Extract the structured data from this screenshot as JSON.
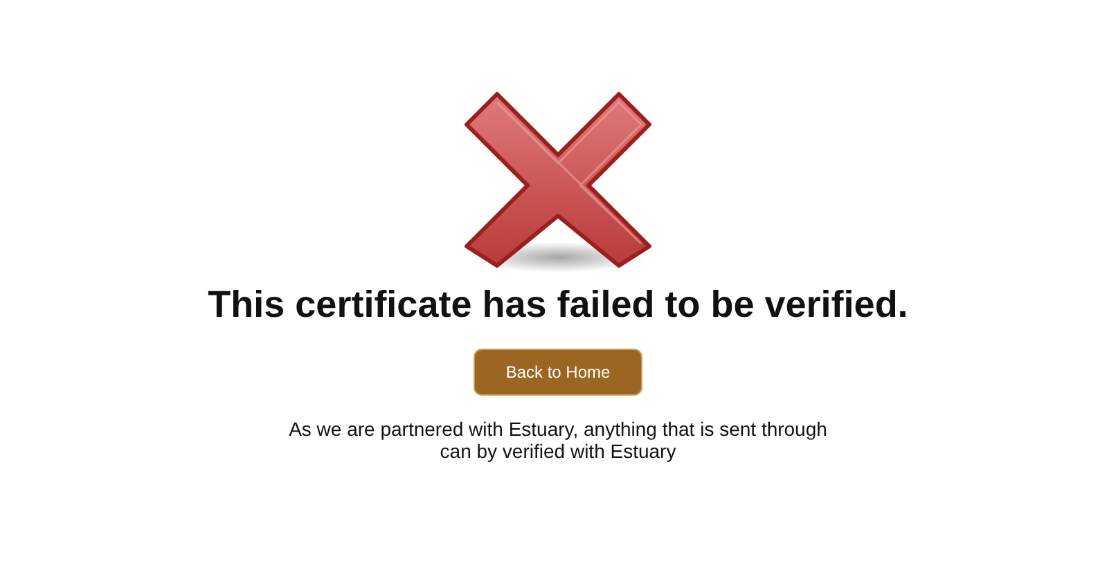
{
  "heading": "This certificate has failed to be verified.",
  "button": {
    "label": "Back to Home"
  },
  "message": "As we are partnered with Estuary, anything that is sent through can by verified with Estuary"
}
